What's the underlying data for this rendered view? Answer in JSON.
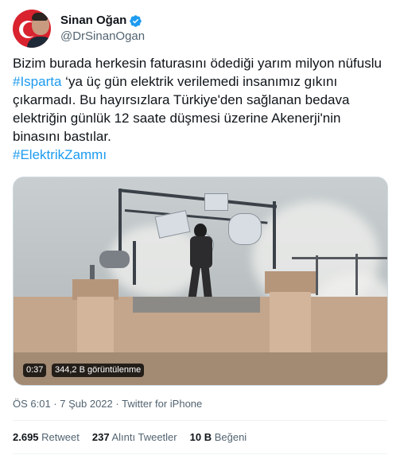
{
  "author": {
    "display_name": "Sinan Oğan",
    "handle": "@DrSinanOgan",
    "verified": true,
    "avatar_icon": "profile-avatar-turkish-flag"
  },
  "tweet": {
    "text_part1": "Bizim burada herkesin faturasını ödediği yarım milyon nüfuslu ",
    "hashtag1": "#Isparta",
    "text_part2": " ‘ya üç gün elektrik verilemedi insanımız gıkını çıkarmadı. Bu hayırsızlara Türkiye'den sağlanan bedava elektriğin günlük 12 saate düşmesi üzerine Akenerji'nin binasını bastılar.",
    "hashtag2": "#ElektrikZammı"
  },
  "media": {
    "duration": "0:37",
    "views": "344,2 B görüntülenme"
  },
  "meta": {
    "time": "ÖS 6:01",
    "separator": " · ",
    "date": "7 Şub 2022",
    "source": "Twitter for iPhone"
  },
  "stats": {
    "retweets_num": "2.695",
    "retweets_label": "Retweet",
    "quotes_num": "237",
    "quotes_label": "Alıntı Tweetler",
    "likes_num": "10 B",
    "likes_label": "Beğeni"
  },
  "colors": {
    "link": "#1d9bf0",
    "secondary_text": "#536471",
    "primary_text": "#0f1419"
  }
}
